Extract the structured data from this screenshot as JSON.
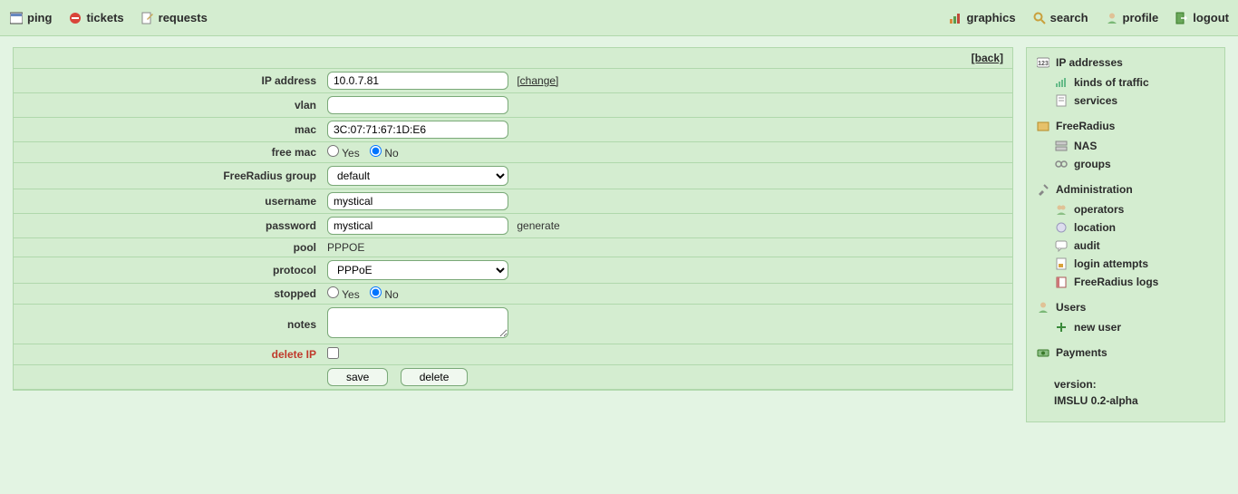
{
  "topbar": {
    "left": [
      {
        "id": "ping",
        "label": "ping"
      },
      {
        "id": "tickets",
        "label": "tickets"
      },
      {
        "id": "requests",
        "label": "requests"
      }
    ],
    "right": [
      {
        "id": "graphics",
        "label": "graphics"
      },
      {
        "id": "search",
        "label": "search"
      },
      {
        "id": "profile",
        "label": "profile"
      },
      {
        "id": "logout",
        "label": "logout"
      }
    ]
  },
  "back_label": "[back]",
  "form": {
    "ip_label": "IP address",
    "ip_value": "10.0.7.81",
    "ip_change": "[change]",
    "vlan_label": "vlan",
    "vlan_value": "",
    "mac_label": "mac",
    "mac_value": "3C:07:71:67:1D:E6",
    "free_mac_label": "free mac",
    "yes": "Yes",
    "no": "No",
    "free_mac_selected": "no",
    "fr_group_label": "FreeRadius group",
    "fr_group_value": "default",
    "username_label": "username",
    "username_value": "mystical",
    "password_label": "password",
    "password_value": "mystical",
    "generate": "generate",
    "pool_label": "pool",
    "pool_value": "PPPOE",
    "protocol_label": "protocol",
    "protocol_value": "PPPoE",
    "stopped_label": "stopped",
    "stopped_selected": "no",
    "notes_label": "notes",
    "notes_value": "",
    "delete_ip_label": "delete IP",
    "save": "save",
    "delete": "delete"
  },
  "sidebar": {
    "ip_addresses": "IP addresses",
    "kinds_of_traffic": "kinds of traffic",
    "services": "services",
    "freeradius": "FreeRadius",
    "nas": "NAS",
    "groups": "groups",
    "administration": "Administration",
    "operators": "operators",
    "location": "location",
    "audit": "audit",
    "login_attempts": "login attempts",
    "freeradius_logs": "FreeRadius logs",
    "users": "Users",
    "new_user": "new user",
    "payments": "Payments",
    "version_label": "version:",
    "version_value": "IMSLU 0.2-alpha"
  }
}
